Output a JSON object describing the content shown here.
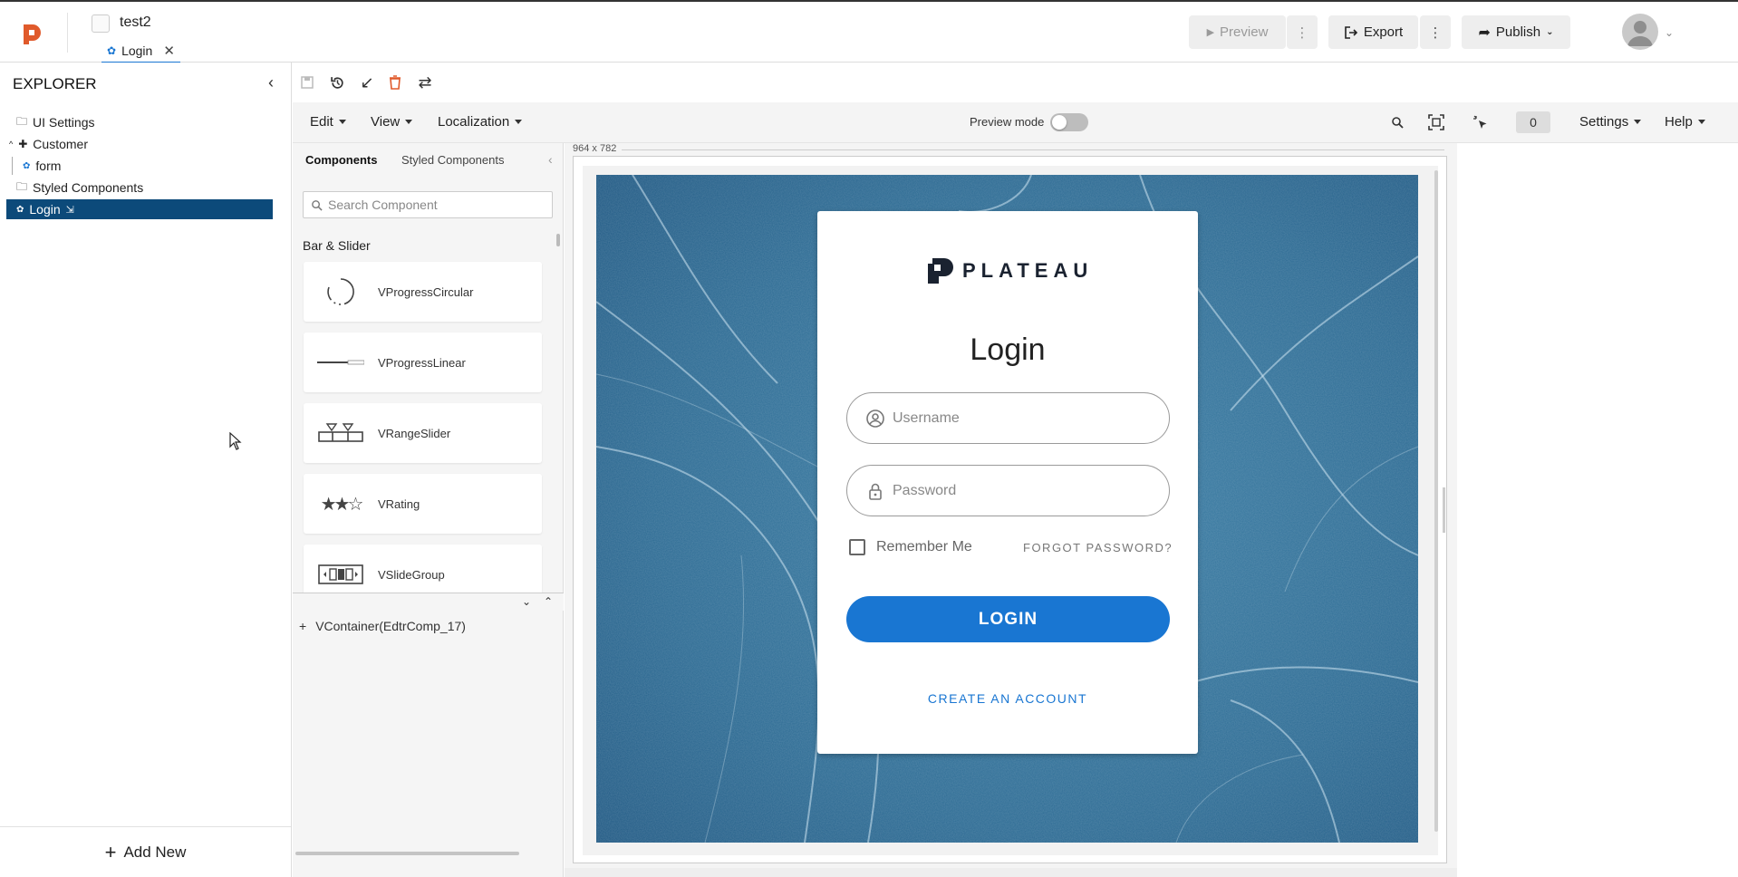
{
  "header": {
    "project_name": "test2",
    "page_tab": "Login",
    "buttons": {
      "preview": "Preview",
      "export": "Export",
      "publish": "Publish"
    }
  },
  "explorer": {
    "title": "EXPLORER",
    "items": [
      {
        "label": "UI Settings",
        "icon": "folder-icon"
      },
      {
        "label": "Customer",
        "icon": "puzzle-icon"
      },
      {
        "label": "form",
        "icon": "palette-icon"
      },
      {
        "label": "Styled Components",
        "icon": "folder-icon"
      },
      {
        "label": "Login",
        "icon": "palette-icon",
        "selected": true
      }
    ],
    "add_new": "Add New"
  },
  "menus": {
    "edit": "Edit",
    "view": "View",
    "localization": "Localization",
    "preview_mode": "Preview mode",
    "counter": "0",
    "settings": "Settings",
    "help": "Help"
  },
  "components_panel": {
    "tabs": [
      "Components",
      "Styled Components"
    ],
    "search_placeholder": "Search Component",
    "group": "Bar & Slider",
    "items": [
      "VProgressCircular",
      "VProgressLinear",
      "VRangeSlider",
      "VRating",
      "VSlideGroup"
    ],
    "tree_node": "VContainer(EdtrComp_17)"
  },
  "canvas": {
    "dimensions": "964 x 782"
  },
  "login_form": {
    "brand": "PLATEAU",
    "title": "Login",
    "username_placeholder": "Username",
    "password_placeholder": "Password",
    "remember_me": "Remember Me",
    "forgot_password": "FORGOT PASSWORD?",
    "login_button": "LOGIN",
    "create_account": "CREATE AN ACCOUNT"
  },
  "colors": {
    "accent": "#1976d2",
    "selected_item": "#0c4a7a",
    "logo": "#e05a2b"
  }
}
